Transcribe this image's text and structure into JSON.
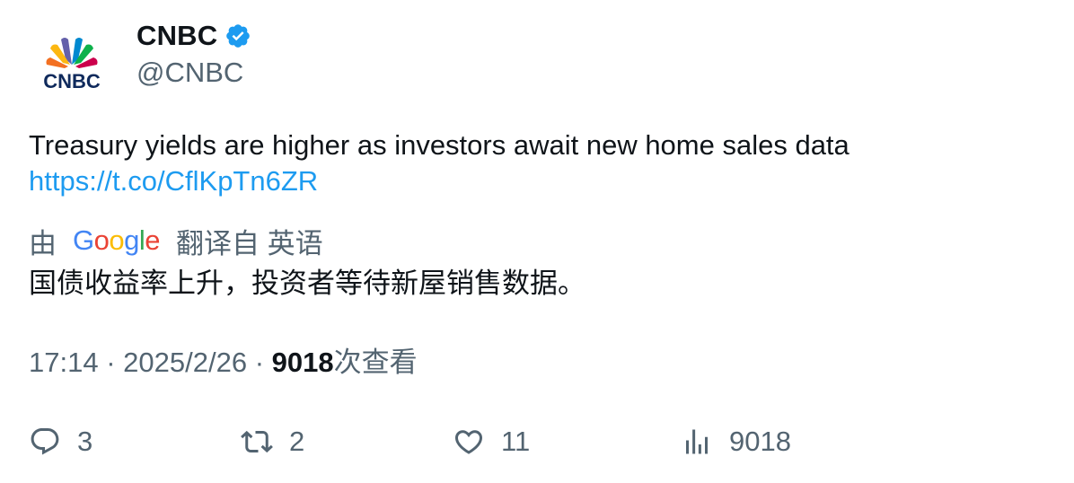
{
  "author": {
    "display_name": "CNBC",
    "handle": "@CNBC",
    "avatar_icon": "cnbc-peacock-logo",
    "avatar_text": "CNBC",
    "verified_icon": "verified-badge-icon",
    "verified_color": "#1d9bf0"
  },
  "tweet": {
    "text": "Treasury yields are higher as investors await new home sales data",
    "link": "https://t.co/CflKpTn6ZR"
  },
  "translation": {
    "prefix": "由",
    "provider": "Google",
    "suffix": "翻译自 英语",
    "text": "国债收益率上升，投资者等待新屋销售数据。"
  },
  "meta": {
    "time": "17:14",
    "date": "2025/2/26",
    "separator": "·",
    "views": "9018",
    "views_label": "次查看"
  },
  "actions": {
    "reply_count": "3",
    "retweet_count": "2",
    "like_count": "11",
    "views_count": "9018"
  },
  "colors": {
    "text": "#0f1419",
    "secondary": "#536471",
    "link": "#1d9bf0"
  }
}
